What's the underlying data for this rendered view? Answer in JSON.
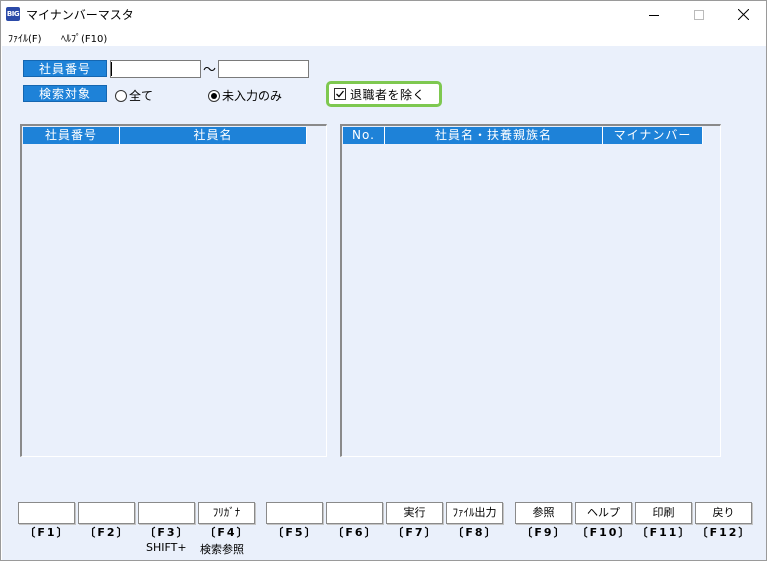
{
  "window": {
    "icon_text": "BIG",
    "title": "マイナンバーマスタ"
  },
  "menu": {
    "file": "ﾌｧｲﾙ(F)",
    "help": "ﾍﾙﾌﾟ(F10)"
  },
  "search": {
    "employee_no_label": "社員番号",
    "range_separator": "～",
    "from_value": "",
    "to_value": "",
    "target_label": "検索対象",
    "radio_all": "全て",
    "radio_unentered": "未入力のみ",
    "selected": "未入力のみ",
    "exclude_retired_label": "退職者を除く",
    "exclude_retired_checked": true
  },
  "left_list": {
    "columns": [
      "社員番号",
      "社員名"
    ],
    "rows": []
  },
  "right_list": {
    "columns": [
      "No.",
      "社員名・扶養親族名",
      "マイナンバー"
    ],
    "rows": []
  },
  "function_keys": [
    {
      "key": "〔F1〕",
      "label": ""
    },
    {
      "key": "〔F2〕",
      "label": ""
    },
    {
      "key": "〔F3〕",
      "label": ""
    },
    {
      "key": "〔F4〕",
      "label": "ﾌﾘｶﾞﾅ"
    },
    {
      "key": "〔F5〕",
      "label": ""
    },
    {
      "key": "〔F6〕",
      "label": ""
    },
    {
      "key": "〔F7〕",
      "label": "実行"
    },
    {
      "key": "〔F8〕",
      "label": "ﾌｧｲﾙ出力"
    },
    {
      "key": "〔F9〕",
      "label": "参照"
    },
    {
      "key": "〔F10〕",
      "label": "ヘルプ"
    },
    {
      "key": "〔F11〕",
      "label": "印刷"
    },
    {
      "key": "〔F12〕",
      "label": "戻り"
    }
  ],
  "shift_text": "SHIFT+",
  "shift_f4_label": "検索参照",
  "colors": {
    "header_blue": "#1e82d8",
    "client_bg": "#eaf0fb",
    "highlight_green": "#7ec850"
  }
}
